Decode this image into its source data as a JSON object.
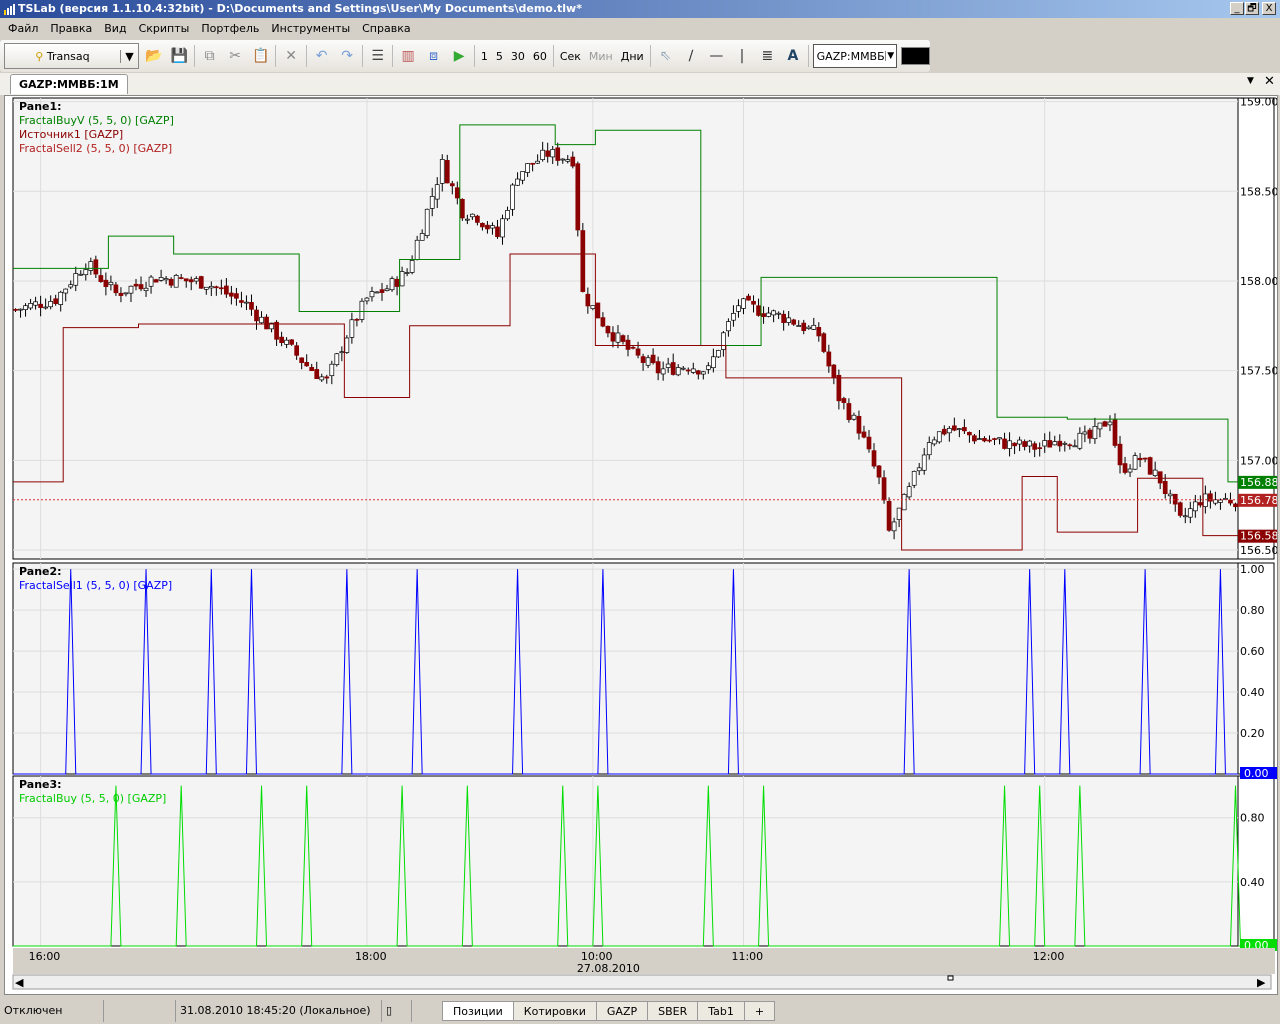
{
  "window": {
    "title": "TSLab (версия 1.1.10.4:32bit) - D:\\Documents and Settings\\User\\My Documents\\demo.tlw*",
    "minimize": "_",
    "restore": "🗗",
    "close": "X"
  },
  "menu": [
    "Файл",
    "Правка",
    "Вид",
    "Скрипты",
    "Портфель",
    "Инструменты",
    "Справка"
  ],
  "toolbar": {
    "broker": "Transaq",
    "timeframes": [
      "1",
      "5",
      "30",
      "60"
    ],
    "units": [
      "Сек",
      "Мин",
      "Дни"
    ],
    "symbol": "GAZP:MMBБ",
    "icons": [
      "open-icon",
      "save-icon",
      "copy-icon",
      "cut-icon",
      "paste-icon",
      "delete-icon",
      "undo-icon",
      "redo-icon",
      "properties-icon",
      "chart-icon",
      "diagram-icon",
      "play-icon"
    ]
  },
  "chart_tab": "GAZP:MMBБ:1M",
  "chart_data": {
    "type": "candlestick",
    "bars": 244,
    "x_ticks": [
      {
        "bar": 5,
        "label": "16:00"
      },
      {
        "bar": 70,
        "label": "18:00"
      },
      {
        "bar": 115,
        "label": "10:00",
        "sub": "27.08.2010"
      },
      {
        "bar": 145,
        "label": "11:00"
      },
      {
        "bar": 205,
        "label": "12:00"
      }
    ],
    "panes": [
      {
        "title": "Pane1:",
        "legend": [
          {
            "text": "FractalBuyV (5, 5, 0) [GAZP]",
            "color": "#008000"
          },
          {
            "text": "Источник1 [GAZP]",
            "color": "#8b0000"
          },
          {
            "text": "FractalSell2 (5, 5, 0) [GAZP]",
            "color": "#b22222"
          }
        ],
        "ylim": [
          156.45,
          159.02
        ],
        "yticks": [
          "159.00",
          "158.50",
          "158.00",
          "157.50",
          "157.00",
          "156.50"
        ],
        "close_anchors": [
          [
            0,
            157.84
          ],
          [
            8,
            157.9
          ],
          [
            14,
            158.1
          ],
          [
            20,
            157.93
          ],
          [
            28,
            158.02
          ],
          [
            38,
            157.99
          ],
          [
            46,
            157.87
          ],
          [
            52,
            157.7
          ],
          [
            58,
            157.53
          ],
          [
            62,
            157.44
          ],
          [
            66,
            157.7
          ],
          [
            70,
            157.9
          ],
          [
            74,
            157.96
          ],
          [
            78,
            158.05
          ],
          [
            82,
            158.39
          ],
          [
            85,
            158.65
          ],
          [
            89,
            158.39
          ],
          [
            92,
            158.36
          ],
          [
            96,
            158.25
          ],
          [
            100,
            158.6
          ],
          [
            106,
            158.71
          ],
          [
            111,
            158.68
          ],
          [
            113,
            157.93
          ],
          [
            118,
            157.73
          ],
          [
            123,
            157.59
          ],
          [
            128,
            157.5
          ],
          [
            134,
            157.53
          ],
          [
            138,
            157.5
          ],
          [
            141,
            157.7
          ],
          [
            144,
            157.87
          ],
          [
            148,
            157.84
          ],
          [
            154,
            157.79
          ],
          [
            160,
            157.7
          ],
          [
            164,
            157.35
          ],
          [
            168,
            157.18
          ],
          [
            172,
            156.89
          ],
          [
            174,
            156.6
          ],
          [
            178,
            156.83
          ],
          [
            182,
            157.12
          ],
          [
            186,
            157.18
          ],
          [
            192,
            157.12
          ],
          [
            198,
            157.09
          ],
          [
            204,
            157.07
          ],
          [
            208,
            157.12
          ],
          [
            214,
            157.12
          ],
          [
            218,
            157.24
          ],
          [
            220,
            156.95
          ],
          [
            224,
            157.01
          ],
          [
            228,
            156.89
          ],
          [
            232,
            156.66
          ],
          [
            236,
            156.78
          ],
          [
            243,
            156.78
          ]
        ],
        "fractal_buy_steps": [
          [
            0,
            158.07
          ],
          [
            19,
            158.25
          ],
          [
            32,
            158.15
          ],
          [
            57,
            157.83
          ],
          [
            77,
            158.12
          ],
          [
            89,
            158.87
          ],
          [
            108,
            158.76
          ],
          [
            116,
            158.84
          ],
          [
            137,
            157.64
          ],
          [
            149,
            158.02
          ],
          [
            196,
            157.24
          ],
          [
            210,
            157.23
          ],
          [
            242,
            156.88
          ]
        ],
        "fractal_sell_steps": [
          [
            0,
            156.88
          ],
          [
            10,
            157.74
          ],
          [
            25,
            157.76
          ],
          [
            66,
            157.35
          ],
          [
            79,
            157.75
          ],
          [
            99,
            158.15
          ],
          [
            116,
            157.64
          ],
          [
            142,
            157.46
          ],
          [
            177,
            156.5
          ],
          [
            201,
            156.91
          ],
          [
            208,
            156.6
          ],
          [
            224,
            156.9
          ],
          [
            237,
            156.58
          ]
        ],
        "last_price": {
          "value": "156.78",
          "color": "#b22222"
        },
        "buy_label": {
          "value": "156.88",
          "color": "#008000"
        },
        "sell_label": {
          "value": "156.58",
          "color": "#8b0000"
        }
      },
      {
        "title": "Pane2:",
        "legend": [
          {
            "text": "FractalSell1 (5, 5, 0) [GAZP]",
            "color": "#0000ff"
          }
        ],
        "ylim": [
          0,
          1
        ],
        "yticks": [
          "1.00",
          "0.80",
          "0.60",
          "0.40",
          "0.20"
        ],
        "zero_label": "0.00",
        "spikes": [
          11,
          26,
          39,
          47,
          66,
          80,
          100,
          117,
          143,
          178,
          202,
          209,
          225,
          240
        ],
        "color": "#0000ff"
      },
      {
        "title": "Pane3:",
        "legend": [
          {
            "text": "FractalBuy (5, 5, 0) [GAZP]",
            "color": "#00cc00"
          }
        ],
        "ylim": [
          0,
          1
        ],
        "yticks": [
          "0.80",
          "0.40"
        ],
        "zero_label": "0.00",
        "spikes": [
          20,
          33,
          49,
          58,
          77,
          90,
          109,
          116,
          138,
          149,
          197,
          204,
          212,
          243
        ],
        "color": "#00dd00"
      }
    ]
  },
  "status": {
    "connection": "Отключен",
    "datetime": "31.08.2010 18:45:20 (Локальное)"
  },
  "bottom_tabs": [
    "Позиции",
    "Котировки",
    "GAZP",
    "SBER",
    "Tab1",
    "+"
  ]
}
